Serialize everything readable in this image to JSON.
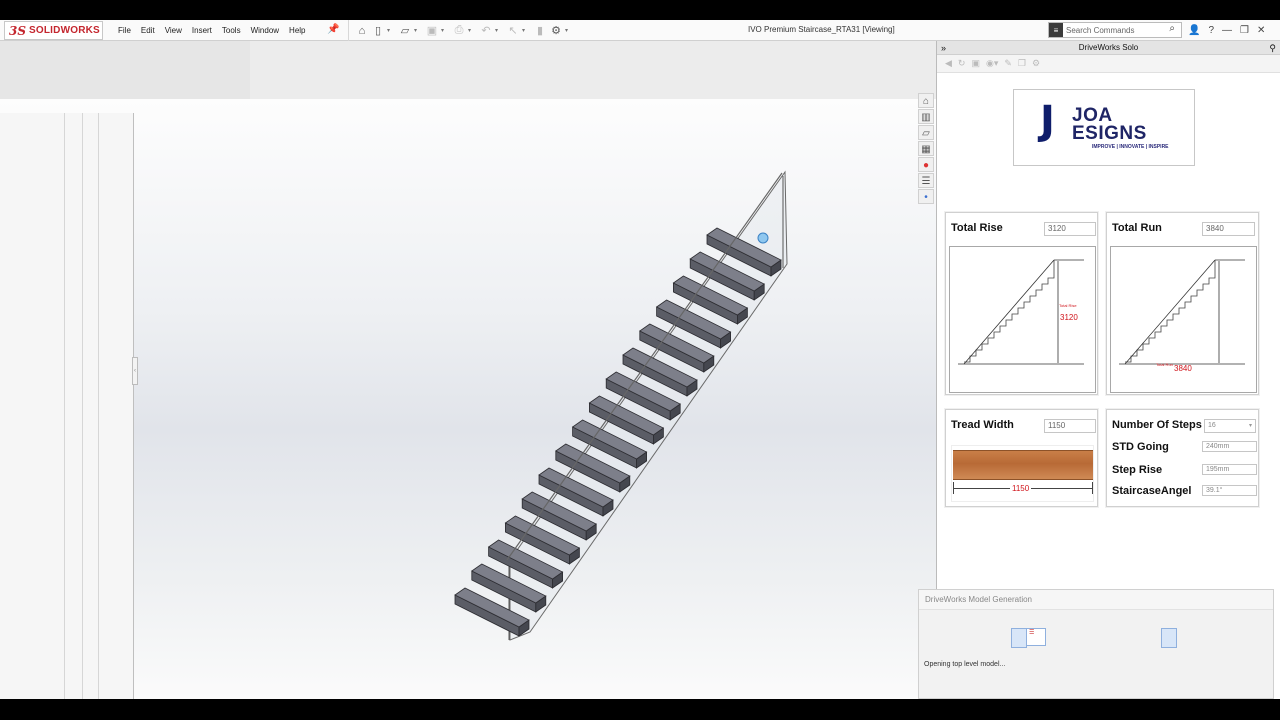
{
  "app": {
    "logo_ds": "3S",
    "logo_name": "SOLIDWORKS",
    "window_title": "IVO Premium Staircase_RTA31 [Viewing]"
  },
  "menu": [
    "File",
    "Edit",
    "View",
    "Insert",
    "Tools",
    "Window",
    "Help"
  ],
  "quick_access_icons": [
    "home-icon",
    "new-icon",
    "open-icon",
    "save-icon",
    "print-icon",
    "undo-icon",
    "select-icon",
    "rebuild-icon",
    "options-icon"
  ],
  "search": {
    "placeholder": "Search Commands"
  },
  "task_pane_icons": [
    "home-icon",
    "parts-icon",
    "folder-icon",
    "palette-icon",
    "appearance-icon",
    "properties-icon",
    "dot-icon"
  ],
  "panel": {
    "title": "DriveWorks Solo",
    "logo": {
      "main1": "JOA",
      "main2": "ESIGNS",
      "tagline": "IMPROVE | INNOVATE | INSPIRE"
    },
    "total_rise": {
      "label": "Total Rise",
      "value": "3120",
      "diagram_label": "Total Rise",
      "diagram_value": "3120"
    },
    "total_run": {
      "label": "Total Run",
      "value": "3840",
      "diagram_label": "Total Run",
      "diagram_value": "3840"
    },
    "tread_width": {
      "label": "Tread Width",
      "value": "1150",
      "diagram_value": "1150"
    },
    "steps": {
      "number_label": "Number Of Steps",
      "number_value": "16",
      "going_label": "STD Going",
      "going_value": "240mm",
      "rise_label": "Step Rise",
      "rise_value": "195mm",
      "angle_label": "StaircaseAngel",
      "angle_value": "39.1°"
    }
  },
  "modal": {
    "title": "DriveWorks Model Generation",
    "status": "Opening top level model..."
  },
  "colors": {
    "brand_red": "#c4262e",
    "logo_navy": "#1f2566",
    "diagram_red": "#d0141b",
    "timber": "#c2773f"
  }
}
